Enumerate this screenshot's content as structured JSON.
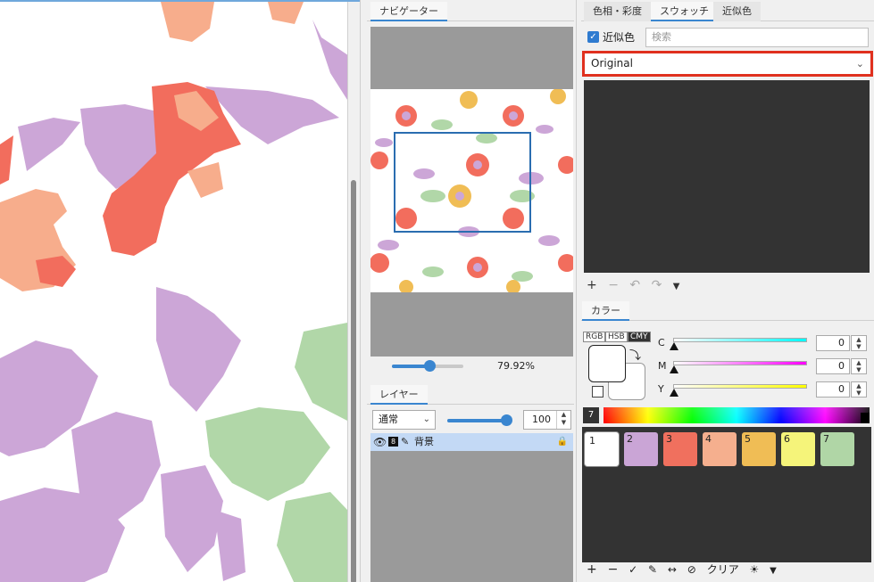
{
  "navigator": {
    "tab_label": "ナビゲーター",
    "zoom_text": "79.92%",
    "zoom_fraction": 0.53
  },
  "layers": {
    "tab_label": "レイヤー",
    "blend_mode": "通常",
    "opacity_value": "100",
    "opacity_fraction": 1.0,
    "layer_name": "背景"
  },
  "swatches": {
    "tabs": [
      "色相・彩度",
      "スウォッチ",
      "近似色"
    ],
    "near_color_label": "近似色",
    "near_color_checked": true,
    "search_placeholder": "検索",
    "selected_swatch_set": "Original"
  },
  "color": {
    "tab_label": "カラー",
    "modes": [
      "RGB",
      "HSB",
      "CMY"
    ],
    "active_mode": "CMY",
    "channels": [
      {
        "label": "C",
        "value": "0",
        "gradient_end": "#00ffff"
      },
      {
        "label": "M",
        "value": "0",
        "gradient_end": "#ff00ff"
      },
      {
        "label": "Y",
        "value": "0",
        "gradient_end": "#ffff00"
      }
    ],
    "hue_number": "7",
    "palette": [
      {
        "num": "1",
        "color": "#ffffff"
      },
      {
        "num": "2",
        "color": "#caa5d6"
      },
      {
        "num": "3",
        "color": "#f0705e"
      },
      {
        "num": "4",
        "color": "#f5af8e"
      },
      {
        "num": "5",
        "color": "#f0bd55"
      },
      {
        "num": "6",
        "color": "#f5f47a"
      },
      {
        "num": "7",
        "color": "#b0d6a6"
      }
    ],
    "toolbar_clear_label": "クリア"
  },
  "canvas_colors": {
    "purple": "#cca6d7",
    "salmon": "#f7ad8c",
    "coral": "#f26d5d",
    "green": "#b1d7a8"
  }
}
